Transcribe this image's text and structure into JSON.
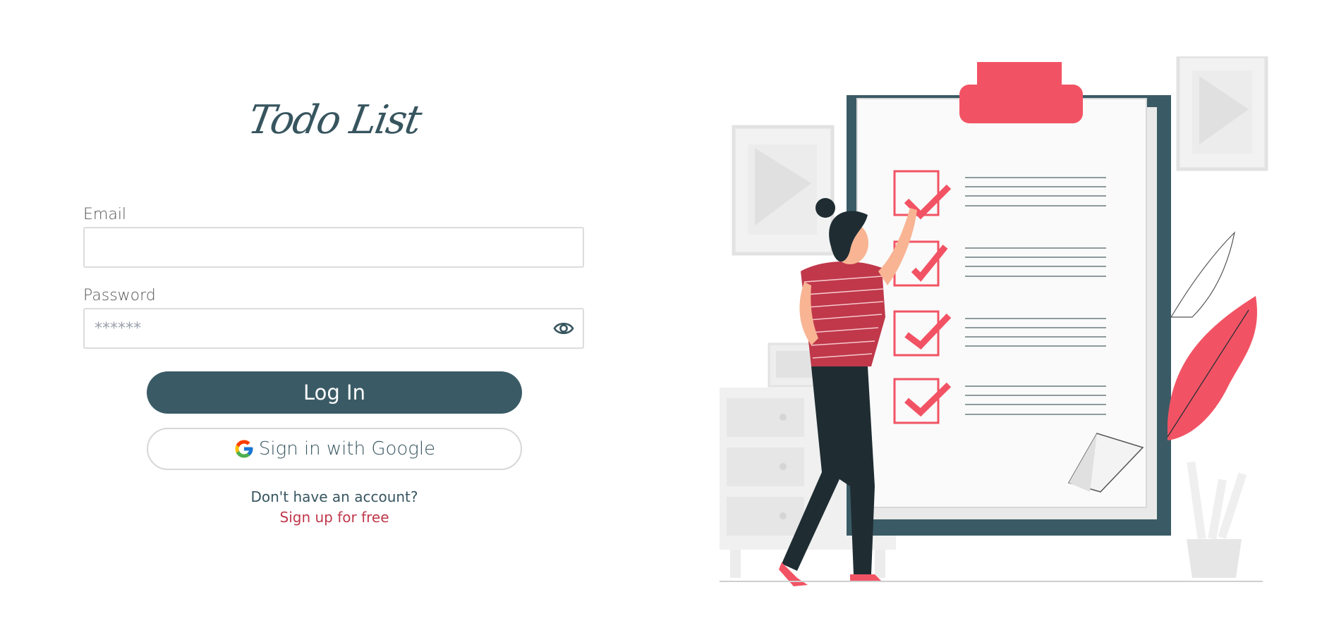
{
  "app": {
    "title": "Todo List"
  },
  "form": {
    "email_label": "Email",
    "email_value": "",
    "password_label": "Password",
    "password_placeholder": "******",
    "login_label": "Log In",
    "google_label": "Sign in with Google",
    "no_account_text": "Don't have an account?",
    "signup_link": "Sign up for free"
  },
  "icons": {
    "show_password": "eye-icon",
    "google": "google-g-icon"
  },
  "colors": {
    "primary": "#3a5b66",
    "accent_red": "#f25364",
    "link_red": "#c0384a",
    "dark_figure": "#1f2d33"
  }
}
